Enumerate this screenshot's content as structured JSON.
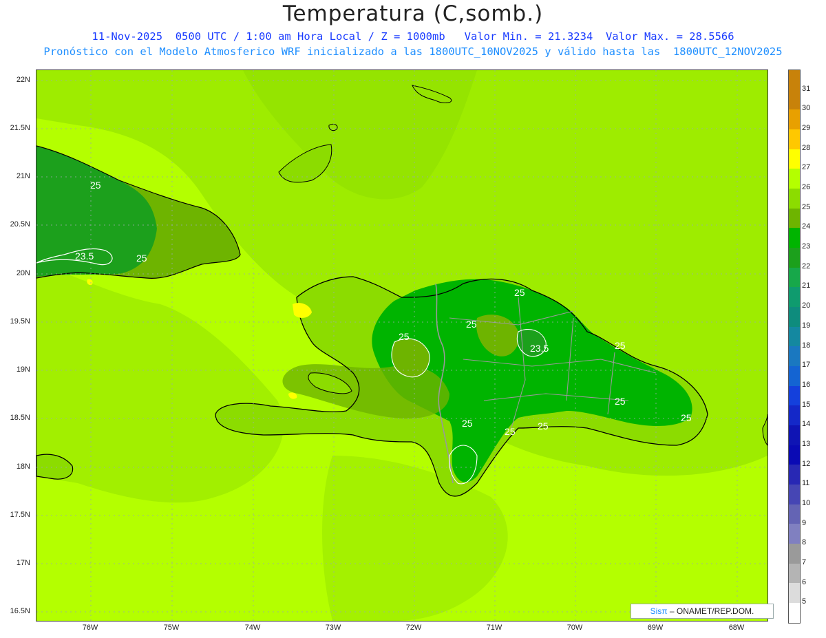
{
  "title": "Temperatura (C,somb.)",
  "subtitle1": "11-Nov-2025  0500 UTC / 1:00 am Hora Local / Z = 1000mb   Valor Min. = 21.3234  Valor Max. = 28.5566",
  "subtitle2": "Pronóstico con el Modelo Atmosferico WRF inicializado a las 1800UTC_10NOV2025 y válido hasta las  1800UTC_12NOV2025",
  "lat_labels": [
    "22N",
    "21.5N",
    "21N",
    "20.5N",
    "20N",
    "19.5N",
    "19N",
    "18.5N",
    "18N",
    "17.5N",
    "17N",
    "16.5N"
  ],
  "lon_labels": [
    "76W",
    "75W",
    "74W",
    "73W",
    "72W",
    "71W",
    "70W",
    "69W",
    "68W"
  ],
  "contour_labels": [
    "25",
    "23.5",
    "25",
    "25",
    "25",
    "23.5",
    "25",
    "25",
    "25",
    "25",
    "25",
    "25",
    "25"
  ],
  "colorbar": {
    "labels": [
      "31",
      "30",
      "29",
      "28",
      "27",
      "26",
      "25",
      "24",
      "23",
      "22",
      "21",
      "20",
      "19",
      "18",
      "17",
      "16",
      "15",
      "14",
      "13",
      "12",
      "11",
      "10",
      "9",
      "8",
      "7",
      "6",
      "5"
    ],
    "colors": [
      "#c8820a",
      "#e8a000",
      "#ffc800",
      "#ffff00",
      "#b4ff00",
      "#8cdc00",
      "#6eb400",
      "#00b400",
      "#1ca01c",
      "#17a84a",
      "#0f9b6e",
      "#0e8c7d",
      "#1488a0",
      "#1a78c0",
      "#1464d2",
      "#1440dc",
      "#1428c8",
      "#0f14b4",
      "#0a0ab4",
      "#2828b4",
      "#4646b4",
      "#6464b4",
      "#8080c0",
      "#9a9a9a",
      "#b4b4b4",
      "#dcdcdc",
      "#ffffff"
    ]
  },
  "credit": {
    "brand": "Sisπ",
    "text": "– ONAMET/REP.DOM."
  }
}
